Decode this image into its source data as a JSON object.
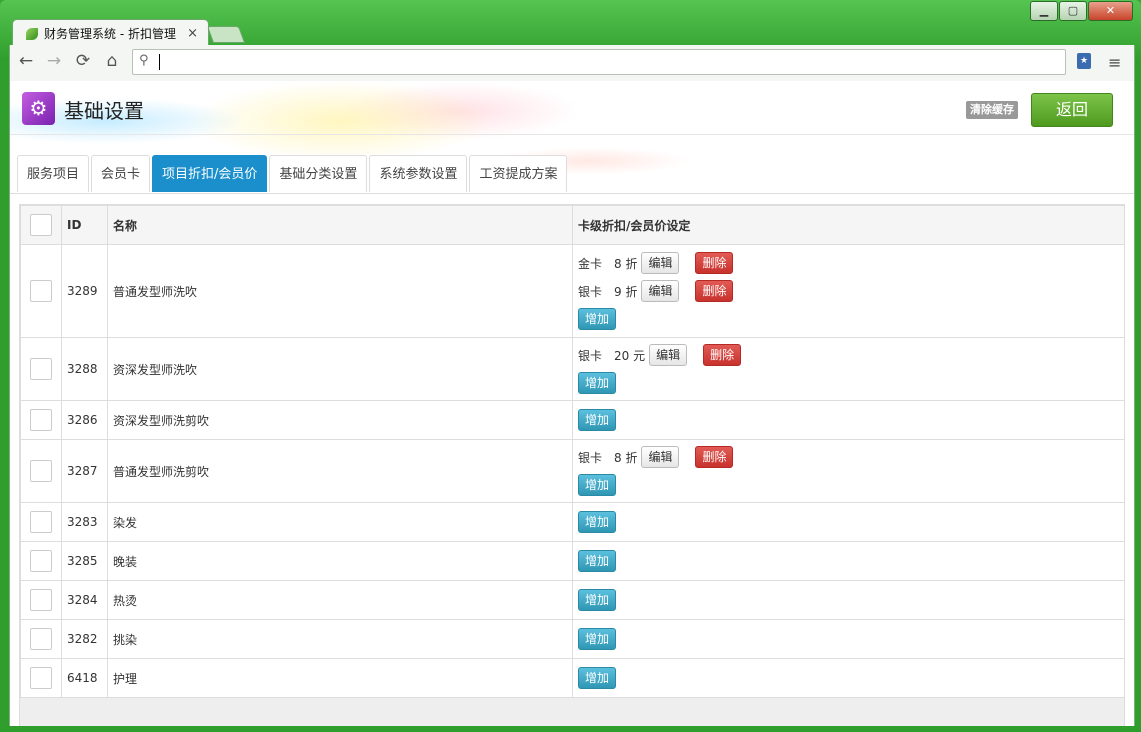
{
  "browser": {
    "tab_title": "财务管理系统 - 折扣管理",
    "tab_close": "×",
    "nav": {
      "back": "←",
      "forward": "→",
      "reload": "⟳",
      "home": "⌂"
    },
    "omnibox_value": "",
    "menu_glyph": "≡"
  },
  "window_controls": {
    "minimize": "▁",
    "maximize": "▢",
    "close": "✕"
  },
  "header": {
    "title": "基础设置",
    "clear_cache": "清除缓存",
    "back": "返回"
  },
  "tabs": [
    {
      "label": "服务项目",
      "active": false
    },
    {
      "label": "会员卡",
      "active": false
    },
    {
      "label": "项目折扣/会员价",
      "active": true
    },
    {
      "label": "基础分类设置",
      "active": false
    },
    {
      "label": "系统参数设置",
      "active": false
    },
    {
      "label": "工资提成方案",
      "active": false
    }
  ],
  "table": {
    "columns": [
      "",
      "ID",
      "名称",
      "卡级折扣/会员价设定"
    ],
    "edit_label": "编辑",
    "delete_label": "删除",
    "add_label": "增加",
    "rows": [
      {
        "id": "3289",
        "name": "普通发型师洗吹",
        "discounts": [
          {
            "card": "金卡",
            "value": "8 折"
          },
          {
            "card": "银卡",
            "value": "9 折"
          }
        ]
      },
      {
        "id": "3288",
        "name": "资深发型师洗吹",
        "discounts": [
          {
            "card": "银卡",
            "value": "20 元"
          }
        ]
      },
      {
        "id": "3286",
        "name": "资深发型师洗剪吹",
        "discounts": []
      },
      {
        "id": "3287",
        "name": "普通发型师洗剪吹",
        "discounts": [
          {
            "card": "银卡",
            "value": "8 折"
          }
        ]
      },
      {
        "id": "3283",
        "name": "染发",
        "discounts": []
      },
      {
        "id": "3285",
        "name": "晚装",
        "discounts": []
      },
      {
        "id": "3284",
        "name": "热烫",
        "discounts": []
      },
      {
        "id": "3282",
        "name": "挑染",
        "discounts": []
      },
      {
        "id": "6418",
        "name": "护理",
        "discounts": []
      }
    ]
  }
}
